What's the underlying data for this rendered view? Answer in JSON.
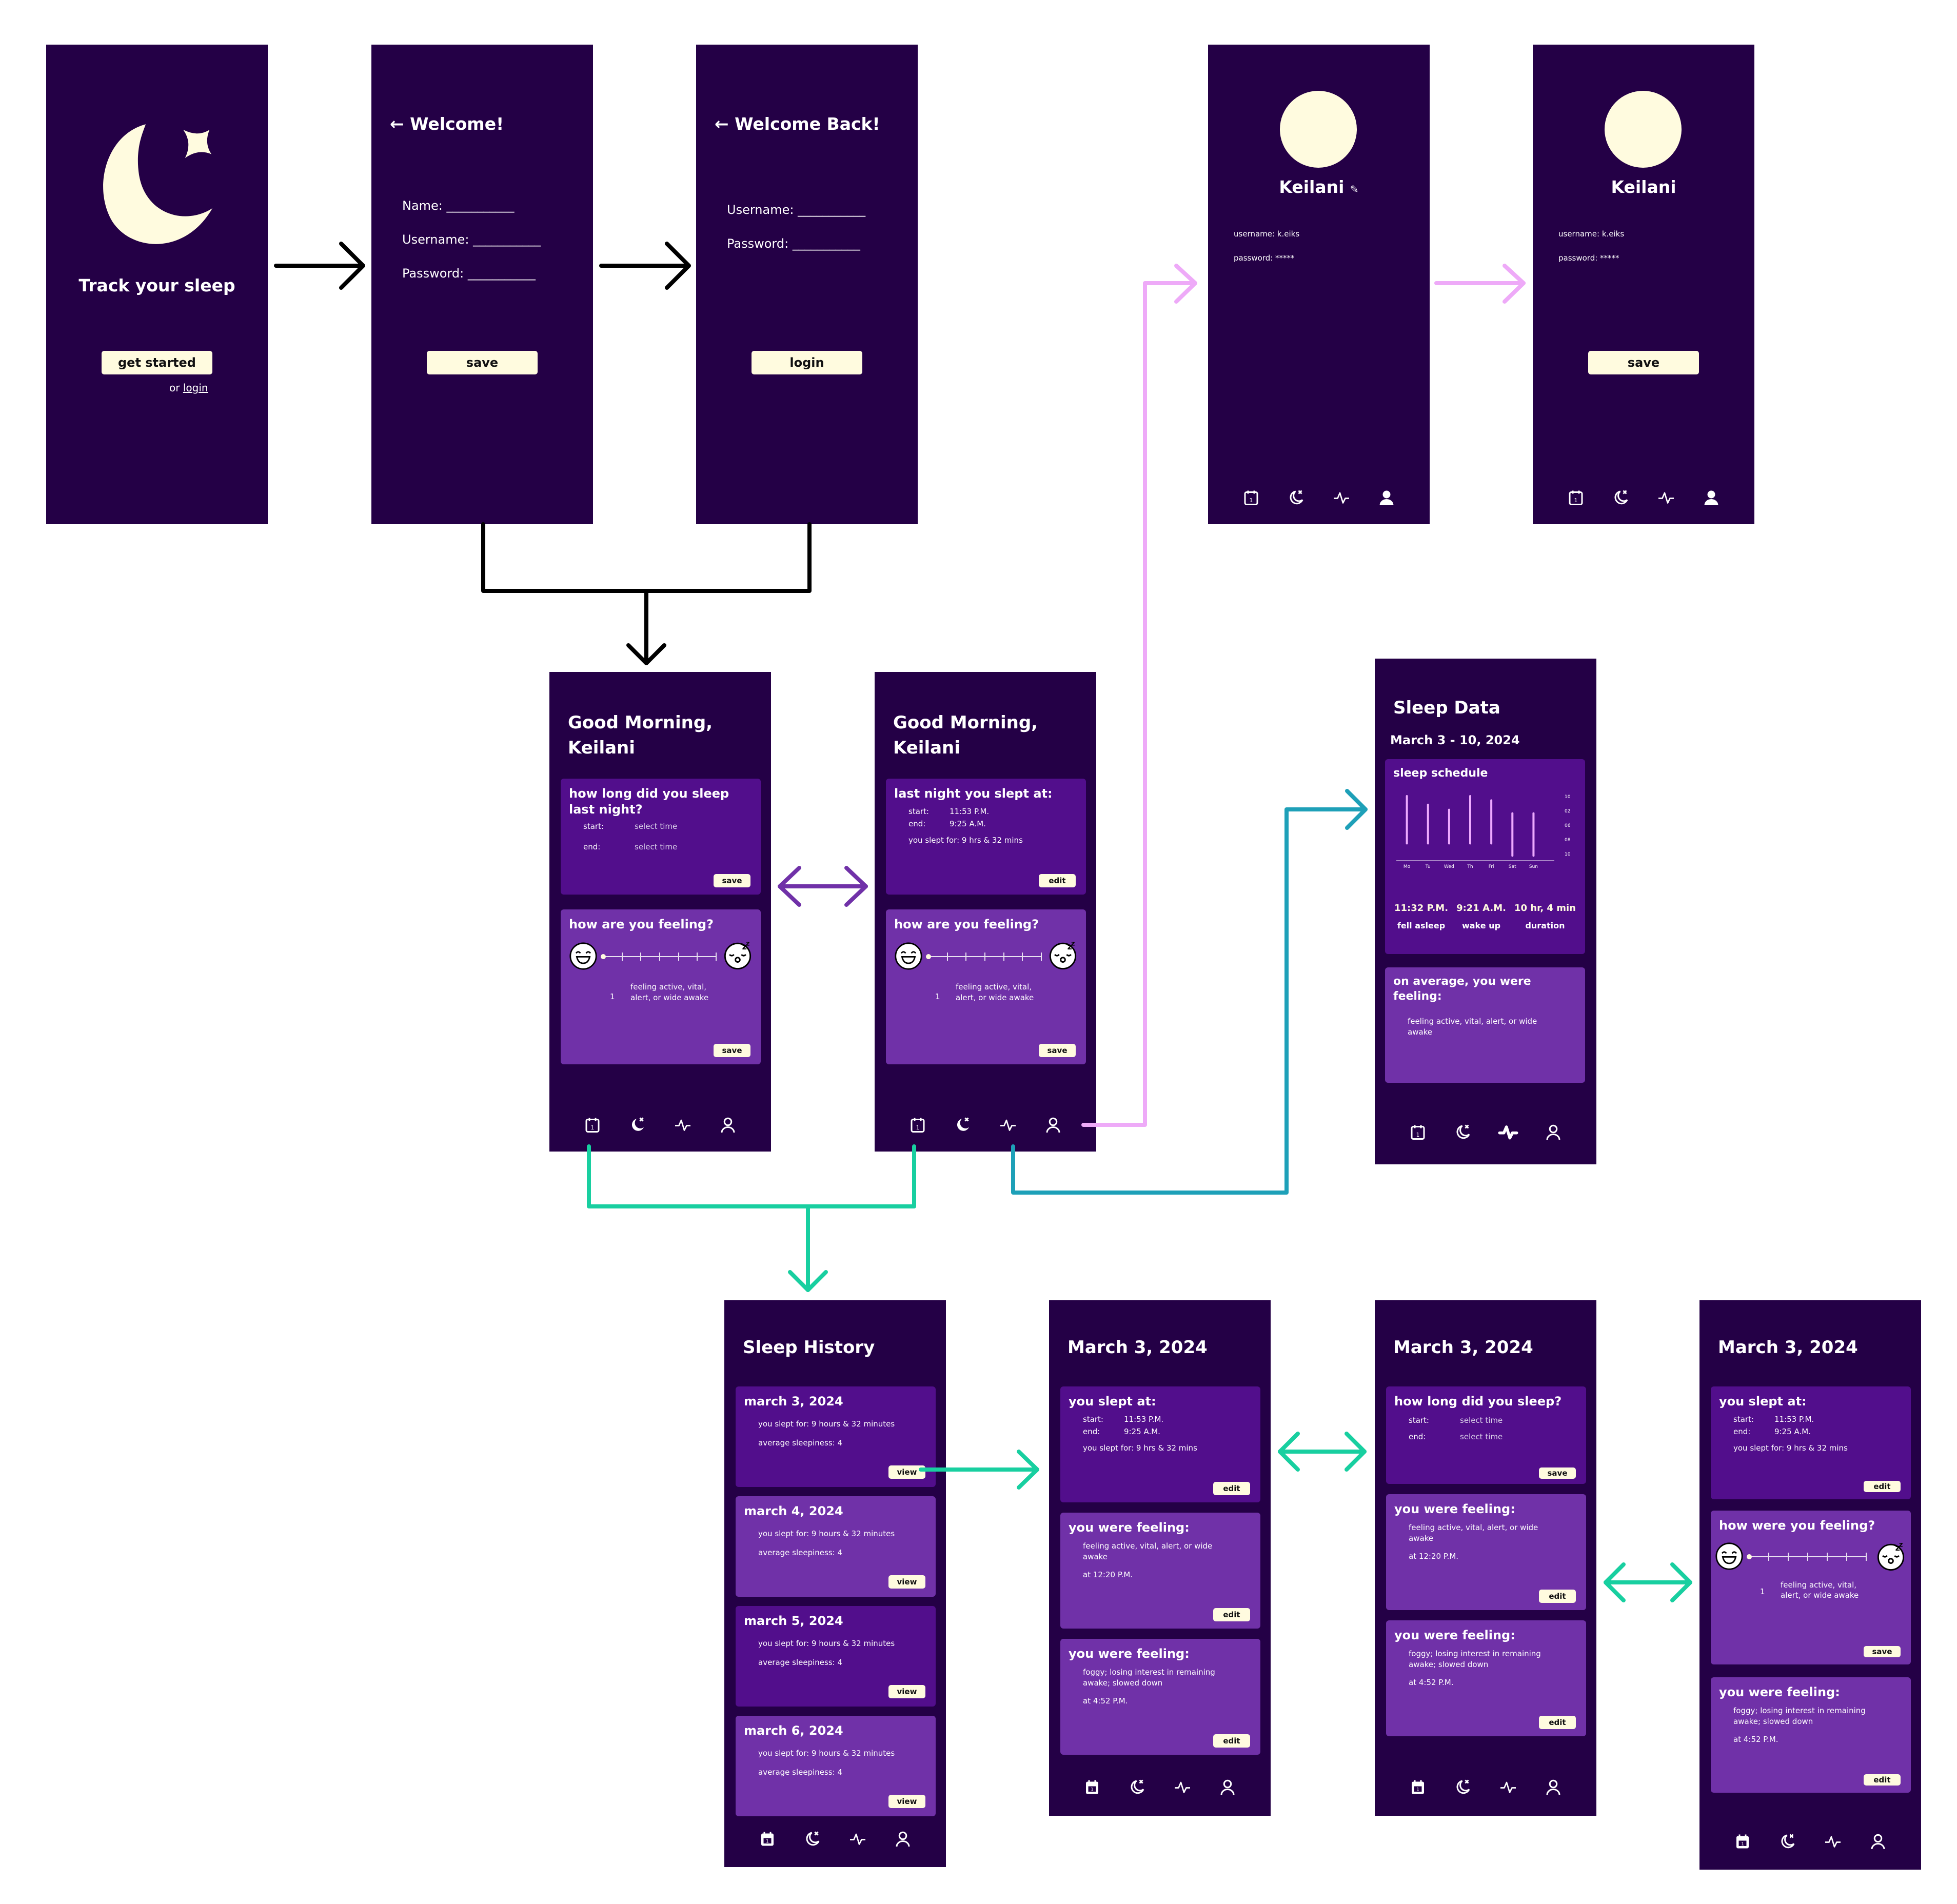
{
  "colors": {
    "screen_bg": "#240046",
    "card_dark": "#520e8c",
    "card_light": "#7031a8",
    "button": "#fffbdf",
    "accent_cream": "#fffbdf",
    "chart_bar": "#eeaaff",
    "arrow_black": "#000000",
    "arrow_purple": "#7031a8",
    "arrow_pink": "#eeaaf8",
    "arrow_teal": "#18cfa0",
    "arrow_blue": "#1ea0b8"
  },
  "splash": {
    "tagline": "Track your sleep",
    "get_started": "get started",
    "or": "or",
    "login_link": "login"
  },
  "signup": {
    "title": "Welcome!",
    "fields": [
      {
        "label": "Name:",
        "value": "___________"
      },
      {
        "label": "Username:",
        "value": "___________"
      },
      {
        "label": "Password:",
        "value": "___________"
      }
    ],
    "save": "save"
  },
  "login": {
    "title": "Welcome Back!",
    "fields": [
      {
        "label": "Username:",
        "value": "___________"
      },
      {
        "label": "Password:",
        "value": "___________"
      }
    ],
    "login": "login"
  },
  "profile": {
    "name": "Keilani",
    "username": "username: k.eiks",
    "password": "password: *****",
    "save": "save"
  },
  "home": {
    "greeting_line1": "Good Morning,",
    "greeting_line2": "Keilani",
    "sleep_question": "how long did you sleep last night?",
    "start_label": "start:",
    "end_label": "end:",
    "select_time": "select time",
    "save": "save",
    "feeling_question": "how are you feeling?",
    "level": "1",
    "level_text": "feeling active, vital, alert, or wide awake",
    "last_night_title": "last night you slept at:",
    "start_value": "11:53 P.M.",
    "end_value": "9:25 A.M.",
    "slept_for": "you slept for: 9 hrs & 32 mins",
    "edit": "edit"
  },
  "sleep_data": {
    "title": "Sleep Data",
    "range": "March 3 - 10, 2024",
    "schedule_title": "sleep schedule",
    "stats": [
      {
        "value": "11:32 P.M.",
        "label": "fell asleep"
      },
      {
        "value": "9:21 A.M.",
        "label": "wake up"
      },
      {
        "value": "10 hr, 4 min",
        "label": "duration"
      }
    ],
    "avg_title": "on average, you were feeling:",
    "avg_text": "feeling active, vital, alert, or wide awake"
  },
  "chart_data": {
    "type": "bar",
    "title": "sleep schedule",
    "categories": [
      "Mo",
      "Tu",
      "Wed",
      "Th",
      "Fri",
      "Sat",
      "Sun"
    ],
    "y_tick_labels": [
      "10",
      "02",
      "06",
      "08",
      "10"
    ],
    "ylabel": "",
    "xlabel": "",
    "grid": false,
    "series": [
      {
        "name": "sleep start (tick index)",
        "values": [
          0.0,
          0.6,
          0.95,
          0.0,
          0.3,
          1.2,
          1.2
        ]
      },
      {
        "name": "sleep end (tick index)",
        "values": [
          3.3,
          3.3,
          3.3,
          3.3,
          3.3,
          4.15,
          4.15
        ]
      }
    ]
  },
  "history": {
    "title": "Sleep History",
    "entries": [
      {
        "date": "march 3, 2024",
        "slept": "you slept for: 9 hours & 32 minutes",
        "sleepiness": "average sleepiness: 4",
        "view": "view"
      },
      {
        "date": "march 4, 2024",
        "slept": "you slept for: 9 hours & 32 minutes",
        "sleepiness": "average sleepiness: 4",
        "view": "view"
      },
      {
        "date": "march 5, 2024",
        "slept": "you slept for: 9 hours & 32 minutes",
        "sleepiness": "average sleepiness: 4",
        "view": "view"
      },
      {
        "date": "march 6, 2024",
        "slept": "you slept for: 9 hours & 32 minutes",
        "sleepiness": "average sleepiness: 4",
        "view": "view"
      }
    ]
  },
  "detail": {
    "date": "March 3, 2024",
    "slept_at": "you slept at:",
    "start_label": "start:",
    "end_label": "end:",
    "start_value": "11:53 P.M.",
    "end_value": "9:25 A.M.",
    "slept_for": "you slept for: 9 hrs & 32 mins",
    "edit": "edit",
    "save": "save",
    "were_feeling": "you were feeling:",
    "feeling1": "feeling active, vital, alert, or wide awake",
    "time1": "at 12:20 P.M.",
    "feeling2": "foggy; losing interest in remaining awake; slowed down",
    "time2": "at 4:52 P.M.",
    "how_long": "how long did you sleep?",
    "select_time": "select time",
    "how_were": "how were you feeling?",
    "level": "1",
    "level_text": "feeling active, vital, alert, or wide awake"
  },
  "nav": {
    "items": [
      "calendar-icon",
      "moon-star-icon",
      "pulse-icon",
      "user-icon"
    ]
  }
}
